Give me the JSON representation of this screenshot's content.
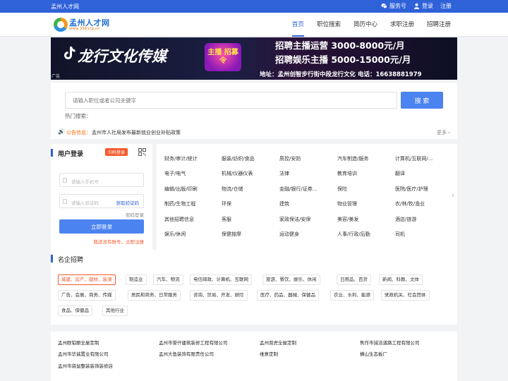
{
  "topbar": {
    "site_name": "孟州人才网",
    "service": "服务号",
    "login": "登录",
    "register": "注册"
  },
  "header": {
    "logo_text": "孟州人才网",
    "logo_url": "www.3381cp.cn",
    "nav": [
      "首页",
      "职位搜索",
      "简历中心",
      "求职注册",
      "招聘注册"
    ],
    "active_nav": 0
  },
  "banner": {
    "company": "龙行文化传媒",
    "badge": "主播 招募令",
    "line1": "招聘主播运营 3000-8000元/月",
    "line2": "招聘娱乐主播 5000-15000元/月",
    "address": "地址：孟州创智步行街中段龙行文化 电话：16638881979",
    "ad_tag": "广告"
  },
  "search": {
    "placeholder": "请输入职位或者公司关键字",
    "button": "搜 索",
    "hot_label": "热门搜索："
  },
  "notice": {
    "label": "公告信息：",
    "text": "孟州市人社局发布最新就业创业补贴政策",
    "more": "更多 ›"
  },
  "login": {
    "title": "用户登录",
    "scan": "扫码登录",
    "phone_placeholder": "请输入手机号",
    "code_placeholder": "请输入验证码",
    "get_code": "获取验证码",
    "password_login": "密码登录",
    "submit": "立即登录",
    "register_prompt": "我还没有账号，立即注册"
  },
  "categories": [
    [
      "财务/审计/统计",
      "服装/纺织/食品",
      "质控/安防",
      "汽车制造/服务",
      "计算机/互联网/..."
    ],
    [
      "电子/电气",
      "机械/仪器仪表",
      "法律",
      "教育培训",
      "翻译"
    ],
    [
      "编辑/出版/印刷",
      "物流/仓储",
      "金融/银行/证券...",
      "保险",
      "医院/医疗/护理"
    ],
    [
      "制药/生物工程",
      "环保",
      "建筑",
      "物业管理",
      "农/林/牧/渔业"
    ],
    [
      "其他招聘信息",
      "客服",
      "家政保洁/安保",
      "美容/美发",
      "酒店/旅游"
    ],
    [
      "娱乐/休闲",
      "保健按摩",
      "运动健身",
      "人事/行政/后勤",
      "司机"
    ]
  ],
  "famous": {
    "title": "名企招聘",
    "tags": [
      "城建、房产、建材、装潢",
      "制造业",
      "汽车、物流",
      "电信邮政、计算机、互联网",
      "旅游、餐饮、娱乐、休闲",
      "日用品、百货",
      "新闻、科教、文体",
      "广告、会展、商务、传媒",
      "居民和商务、日常服务",
      "咨询、贸易、开发、财险",
      "医疗、药品、器械、保健品",
      "农业、水利、能源",
      "党政机关、社会团体",
      "食品、保健品",
      "其他行业"
    ]
  },
  "companies": [
    [
      "孟州欧铂丽全屋定制",
      "孟州市誉仟建筑装修工程有限公司",
      "孟州双虎全屋定制",
      "焦作市诚洁道路工程有限公司"
    ],
    [
      "孟州市华诚置业有限公司",
      "孟州大鱼装饰有限责任公司",
      "维意定制",
      "横山生态板厂"
    ],
    [
      "孟州市袋鼠整装装饰装修店"
    ]
  ]
}
